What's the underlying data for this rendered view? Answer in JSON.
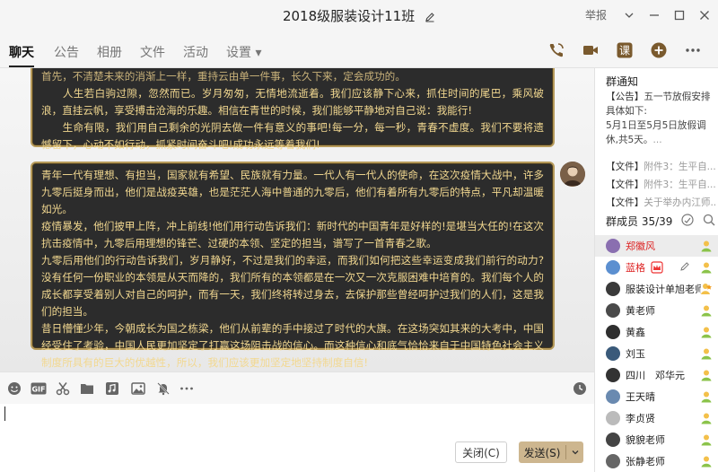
{
  "window": {
    "title": "2018级服装设计11班",
    "report": "举报"
  },
  "tabs": [
    {
      "label": "聊天"
    },
    {
      "label": "公告"
    },
    {
      "label": "相册"
    },
    {
      "label": "文件"
    },
    {
      "label": "活动"
    },
    {
      "label": "设置 ▾"
    }
  ],
  "chat": {
    "msg1": [
      "首先，不清楚未来的消渐上一样，重持云由单一件事，长久下来，定会成功的。",
      "　　人生若白驹过隙，忽然而已。岁月匆匆，无情地流逝着。我们应该静下心来，抓住时间的尾巴，乘风破浪，直挂云帆，享受搏击沧海的乐趣。相信在青世的时候，我们能够平静地对自己说：我能行!",
      "　　生命有限，我们用自己剩余的光阴去做一件有意义的事吧!每一分，每一秒，青春不虚度。我们不要将遗憾留下，心动不如行动，抓紧时间奋斗吧!成功永远等着我们!"
    ],
    "msg2": [
      "青年一代有理想、有担当，国家就有希望、民族就有力量。一代人有一代人的使命，在这次疫情大战中，许多九零后挺身而出，他们是战疫英雄，也是茫茫人海中普通的九零后，他们有着所有九零后的特点，平凡却温暖如光。",
      "疫情暴发，他们披甲上阵，冲上前线!他们用行动告诉我们：新时代的中国青年是好样的!是堪当大任的!在这次抗击疫情中，九零后用理想的锋芒、过硬的本领、坚定的担当，谱写了一首青春之歌。",
      "九零后用他们的行动告诉我们，岁月静好，不过是我们的幸运，而我们如何把这些幸运变成我们前行的动力?没有任何一份职业的本领是从天而降的，我们所有的本领都是在一次又一次克服困难中培育的。我们每个人的成长都享受着别人对自己的呵护，而有一天，我们终将转过身去，去保护那些曾经呵护过我们的人们，这是我们的担当。",
      "昔日懵懂少年，今朝成长为国之栋梁，他们从前辈的手中接过了时代的大旗。在这场突如其来的大考中，中国经受住了考验，中国人民更加坚定了打赢这场阻击战的信心。而这种信心和底气恰恰来自于中国特色社会主义制度所具有的巨大的优越性，所以，我们应该更加坚定地坚持制度自信!"
    ]
  },
  "input": {
    "close_label": "关闭(C)",
    "send_label": "发送(S)"
  },
  "side": {
    "notice_title": "群通知",
    "notice_tag": "【公告】",
    "notice_text": "五一节放假安排具体如下:",
    "notice_line2": "5月1日至5月5日放假调休,共5天。",
    "notice_more": "...",
    "files": [
      {
        "tag": "【文件】",
        "name": "附件3：生平自..."
      },
      {
        "tag": "【文件】",
        "name": "附件3：生平自..."
      },
      {
        "tag": "【文件】",
        "name": "关于举办内江师..."
      }
    ],
    "members_label": "群成员 35/39",
    "members": [
      {
        "name": "郑徽风",
        "color": "#8a6fb0",
        "red": true,
        "role": "member"
      },
      {
        "name": "蓝格",
        "color": "#5b8fd0",
        "red": true,
        "role": "member"
      },
      {
        "name": "服装设计单旭老师",
        "color": "#3a3a3a",
        "red": false,
        "role": "owner"
      },
      {
        "name": "黄老师",
        "color": "#4a4a4a",
        "red": false,
        "role": "member"
      },
      {
        "name": "黄鑫",
        "color": "#2f2f2f",
        "red": false,
        "role": "member"
      },
      {
        "name": "刘玉",
        "color": "#3a5a7a",
        "red": false,
        "role": "member"
      },
      {
        "name": "四川　邓华元",
        "color": "#333",
        "red": false,
        "role": "member"
      },
      {
        "name": "王天晴",
        "color": "#6a8ab0",
        "red": false,
        "role": "member"
      },
      {
        "name": "李贞贤",
        "color": "#bbb",
        "red": false,
        "role": "member"
      },
      {
        "name": "貌貌老师",
        "color": "#444",
        "red": false,
        "role": "member"
      },
      {
        "name": "张静老师",
        "color": "#666",
        "red": false,
        "role": "member"
      }
    ]
  }
}
